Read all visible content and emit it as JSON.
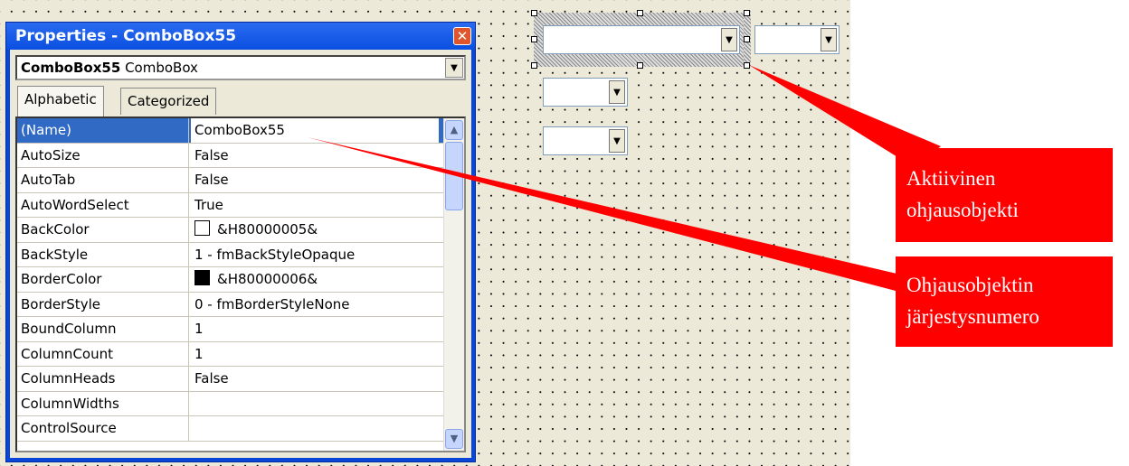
{
  "properties_window": {
    "title": "Properties - ComboBox55",
    "object_name": "ComboBox55",
    "object_type": "ComboBox",
    "tabs": [
      "Alphabetic",
      "Categorized"
    ],
    "rows": [
      {
        "name": "(Name)",
        "value": "ComboBox55"
      },
      {
        "name": "AutoSize",
        "value": "False"
      },
      {
        "name": "AutoTab",
        "value": "False"
      },
      {
        "name": "AutoWordSelect",
        "value": "True"
      },
      {
        "name": "BackColor",
        "value": "&H80000005&",
        "swatch": "#ffffff"
      },
      {
        "name": "BackStyle",
        "value": "1 - fmBackStyleOpaque"
      },
      {
        "name": "BorderColor",
        "value": "&H80000006&",
        "swatch": "#000000"
      },
      {
        "name": "BorderStyle",
        "value": "0 - fmBorderStyleNone"
      },
      {
        "name": "BoundColumn",
        "value": "1"
      },
      {
        "name": "ColumnCount",
        "value": "1"
      },
      {
        "name": "ColumnHeads",
        "value": "False"
      },
      {
        "name": "ColumnWidths",
        "value": ""
      },
      {
        "name": "ControlSource",
        "value": ""
      }
    ]
  },
  "callouts": {
    "active": [
      "Aktiivinen",
      "ohjausobjekti"
    ],
    "order": [
      "Ohjausobjektin",
      "järjestysnumero"
    ]
  },
  "colors": {
    "callout": "#ff0000",
    "selection": "#316ac5",
    "titlebar": "#0a4fe0"
  },
  "icons": {
    "close": "close-icon",
    "dropdown": "chevron-down-icon"
  }
}
